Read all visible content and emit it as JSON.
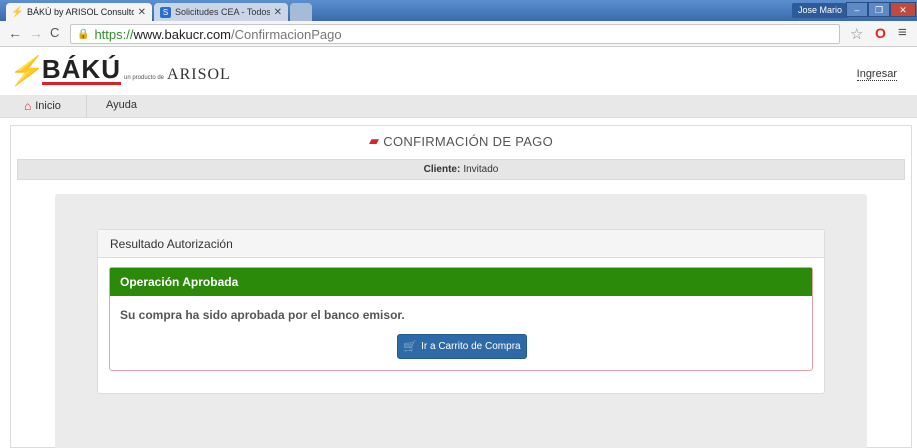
{
  "browser": {
    "tabs": [
      {
        "title": "BÁKÚ by ARISOL Consulto",
        "active": true,
        "icon": "bolt-icon"
      },
      {
        "title": "Solicitudes CEA - Todos lo",
        "active": false,
        "icon": "sharepoint-icon"
      }
    ],
    "user": "Jose Mario",
    "url": {
      "scheme": "https://",
      "host": "www.bakucr.com",
      "path": "/ConfirmacionPago"
    }
  },
  "header": {
    "logo_text": "BÁKÚ",
    "logo_sub": "un producto de",
    "logo_brand": "ARISOL",
    "login_label": "Ingresar"
  },
  "nav": {
    "items": [
      {
        "label": "Inicio",
        "icon": "home-icon"
      },
      {
        "label": "Ayuda"
      }
    ]
  },
  "page": {
    "title": "CONFIRMACIÓN DE PAGO",
    "client_label": "Cliente:",
    "client_value": "Invitado",
    "result_title": "Resultado Autorización",
    "status_title": "Operación Aprobada",
    "message": "Su compra ha sido aprobada por el banco emisor.",
    "cart_button": "Ir a Carrito de Compra"
  },
  "colors": {
    "brand_red": "#d8232a",
    "success_green": "#2b8a0a",
    "button_blue": "#2f6aa8"
  }
}
